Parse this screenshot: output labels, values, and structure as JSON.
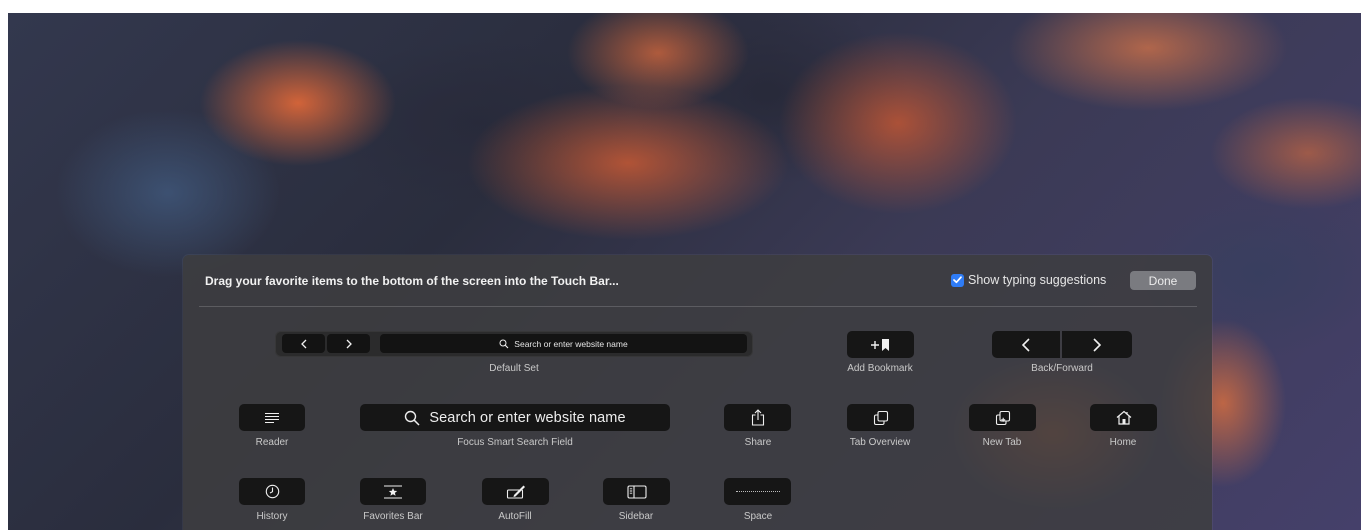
{
  "header": {
    "instruction": "Drag your favorite items to the bottom of the screen into the Touch Bar...",
    "show_suggestions_label": "Show typing suggestions",
    "show_suggestions_checked": true,
    "done_label": "Done"
  },
  "default_set": {
    "search_placeholder": "Search or enter website name",
    "label": "Default Set"
  },
  "items": {
    "add_bookmark": {
      "label": "Add Bookmark",
      "icon": "add-bookmark-icon"
    },
    "back_forward": {
      "label": "Back/Forward",
      "icon": "back-forward-icon"
    },
    "reader": {
      "label": "Reader",
      "icon": "reader-icon"
    },
    "focus_search": {
      "label": "Focus Smart Search Field",
      "placeholder": "Search or enter website name",
      "icon": "search-icon"
    },
    "share": {
      "label": "Share",
      "icon": "share-icon"
    },
    "tab_overview": {
      "label": "Tab Overview",
      "icon": "tab-overview-icon"
    },
    "new_tab": {
      "label": "New Tab",
      "icon": "new-tab-icon"
    },
    "home": {
      "label": "Home",
      "icon": "home-icon"
    },
    "history": {
      "label": "History",
      "icon": "clock-icon"
    },
    "favorites_bar": {
      "label": "Favorites Bar",
      "icon": "favorites-bar-icon"
    },
    "autofill": {
      "label": "AutoFill",
      "icon": "autofill-icon"
    },
    "sidebar": {
      "label": "Sidebar",
      "icon": "sidebar-icon"
    },
    "space": {
      "label": "Space",
      "icon": "space-icon"
    }
  },
  "colors": {
    "panel_bg": "#3e3e40",
    "key_bg": "#161616",
    "checkbox_accent": "#2f7cf6",
    "done_button_bg": "#7a7b80"
  }
}
